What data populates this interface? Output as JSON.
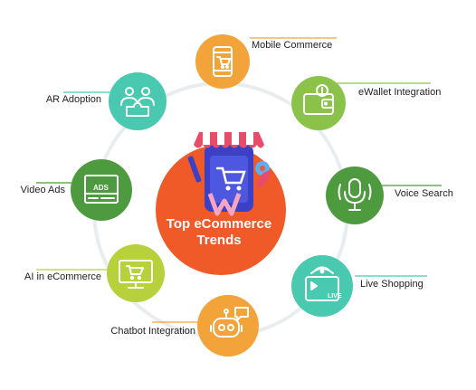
{
  "title": {
    "line1": "Top eCommerce",
    "line2": "Trends"
  },
  "colors": {
    "center": "#F05A28",
    "orange": "#F2A33A",
    "green": "#8BC34A",
    "dark_green": "#4E9A3F",
    "teal": "#49C9B0",
    "light_green": "#9CC95A",
    "lime": "#B6D13B",
    "ring": "#E9EDF0"
  },
  "nodes": [
    {
      "label": "Mobile Commerce",
      "icon": "mobile-cart-icon",
      "color": "#F2A33A"
    },
    {
      "label": "eWallet Integration",
      "icon": "wallet-icon",
      "color": "#8BC34A"
    },
    {
      "label": "Voice Search",
      "icon": "microphone-icon",
      "color": "#4E9A3F"
    },
    {
      "label": "Live Shopping",
      "icon": "live-video-icon",
      "color": "#49C9B0"
    },
    {
      "label": "Chatbot Integration",
      "icon": "chatbot-icon",
      "color": "#F2A33A"
    },
    {
      "label": "AI in eCommerce",
      "icon": "computer-cart-icon",
      "color": "#B6D13B"
    },
    {
      "label": "Video Ads",
      "icon": "ads-screen-icon",
      "color": "#4E9A3F"
    },
    {
      "label": "AR Adoption",
      "icon": "puzzle-people-icon",
      "color": "#49C9B0"
    }
  ]
}
